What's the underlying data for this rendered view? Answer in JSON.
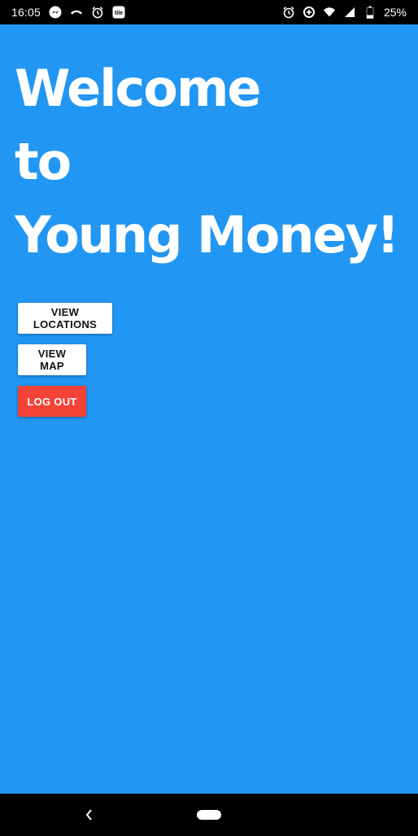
{
  "status_bar": {
    "time": "16:05",
    "battery_percent": "25%",
    "left_icons": [
      "messenger-icon",
      "phone-icon",
      "alarm-icon",
      "tile-icon"
    ],
    "right_icons": [
      "alarm-icon",
      "data-saver-icon",
      "wifi-icon",
      "signal-icon",
      "battery-icon"
    ],
    "tile_label": "tile"
  },
  "main": {
    "headline_line1": "Welcome",
    "headline_line2": "to",
    "headline_line3": "Young Money!",
    "background_color": "#2196F3",
    "buttons": {
      "view_locations": "VIEW LOCATIONS",
      "view_map": "VIEW MAP",
      "log_out": "LOG OUT"
    },
    "logout_color": "#F44336"
  },
  "nav_bar": {
    "back_icon": "chevron-left-icon",
    "home_icon": "home-pill-icon"
  }
}
